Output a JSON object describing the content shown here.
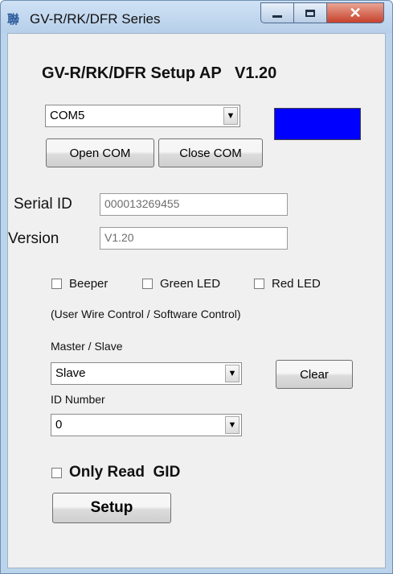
{
  "window": {
    "title": "GV-R/RK/DFR Series",
    "app_icon_glyph": "聯",
    "close_glyph": "✕"
  },
  "heading": "GV-R/RK/DFR Setup AP   V1.20",
  "com": {
    "port_value": "COM5",
    "open_label": "Open COM",
    "close_label": "Close COM",
    "status_color": "#0000ff"
  },
  "serial_id": {
    "label": "Serial ID",
    "value": "000013269455"
  },
  "version": {
    "label": "Version",
    "value": "V1.20"
  },
  "checkboxes": {
    "beeper": "Beeper",
    "green_led": "Green LED",
    "red_led": "Red LED"
  },
  "control_note": "(User Wire Control / Software Control)",
  "master_slave": {
    "label": "Master / Slave",
    "value": "Slave"
  },
  "clear_label": "Clear",
  "id_number": {
    "label": "ID Number",
    "value": "0"
  },
  "only_read_gid": "Only Read  GID",
  "setup_label": "Setup",
  "icons": {
    "dropdown": "▼"
  }
}
